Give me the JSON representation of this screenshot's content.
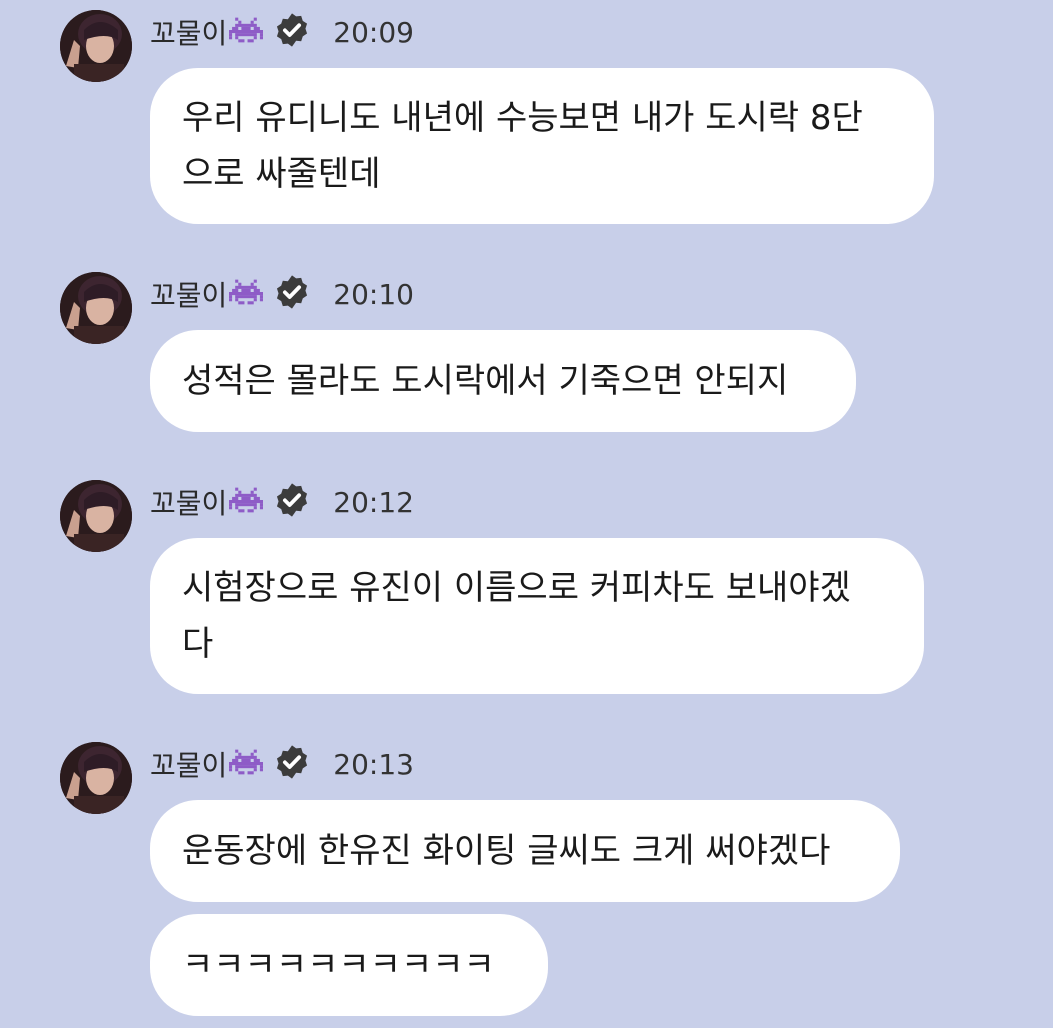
{
  "chat": {
    "messages": [
      {
        "sender": "꼬물이",
        "time": "20:09",
        "texts": [
          "우리 유디니도 내년에 수능보면 내가 도시락 8단\n으로 싸줄텐데"
        ]
      },
      {
        "sender": "꼬물이",
        "time": "20:10",
        "texts": [
          "성적은 몰라도 도시락에서 기죽으면 안되지"
        ]
      },
      {
        "sender": "꼬물이",
        "time": "20:12",
        "texts": [
          "시험장으로 유진이 이름으로 커피차도 보내야겠\n다"
        ]
      },
      {
        "sender": "꼬물이",
        "time": "20:13",
        "texts": [
          "운동장에 한유진 화이팅 글씨도 크게 써야겠다",
          "ㅋㅋㅋㅋㅋㅋㅋㅋㅋㅋ"
        ]
      }
    ]
  },
  "icons": {
    "sender_emoji": "purple-alien-monster-icon",
    "verified": "verified-badge-icon"
  },
  "colors": {
    "background": "#c8cfe9",
    "bubble": "#ffffff",
    "emoji": "#8e5cc7",
    "verified": "#3c3c3c"
  }
}
